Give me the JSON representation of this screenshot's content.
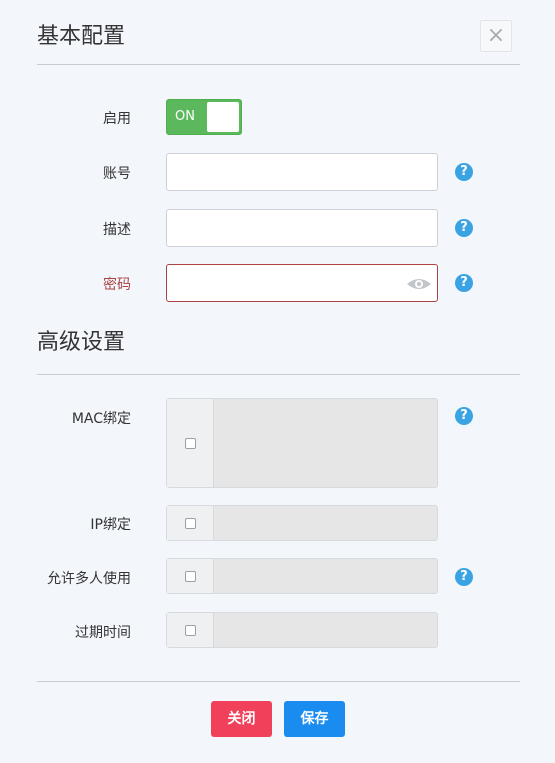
{
  "basic": {
    "title": "基本配置",
    "enable_label": "启用",
    "enable_state": "ON",
    "account_label": "账号",
    "account_value": "",
    "desc_label": "描述",
    "desc_value": "",
    "password_label": "密码",
    "password_value": ""
  },
  "advanced": {
    "title": "高级设置",
    "mac_label": "MAC绑定",
    "ip_label": "IP绑定",
    "multi_label": "允许多人使用",
    "expire_label": "过期时间"
  },
  "help_glyph": "?",
  "close_glyph": "×",
  "footer": {
    "close_label": "关闭",
    "save_label": "保存"
  },
  "colors": {
    "toggle_on": "#5cb85c",
    "error": "#a94442",
    "help": "#3aa3e3",
    "close_button": "#f0405a",
    "save_button": "#1a8cf0"
  }
}
